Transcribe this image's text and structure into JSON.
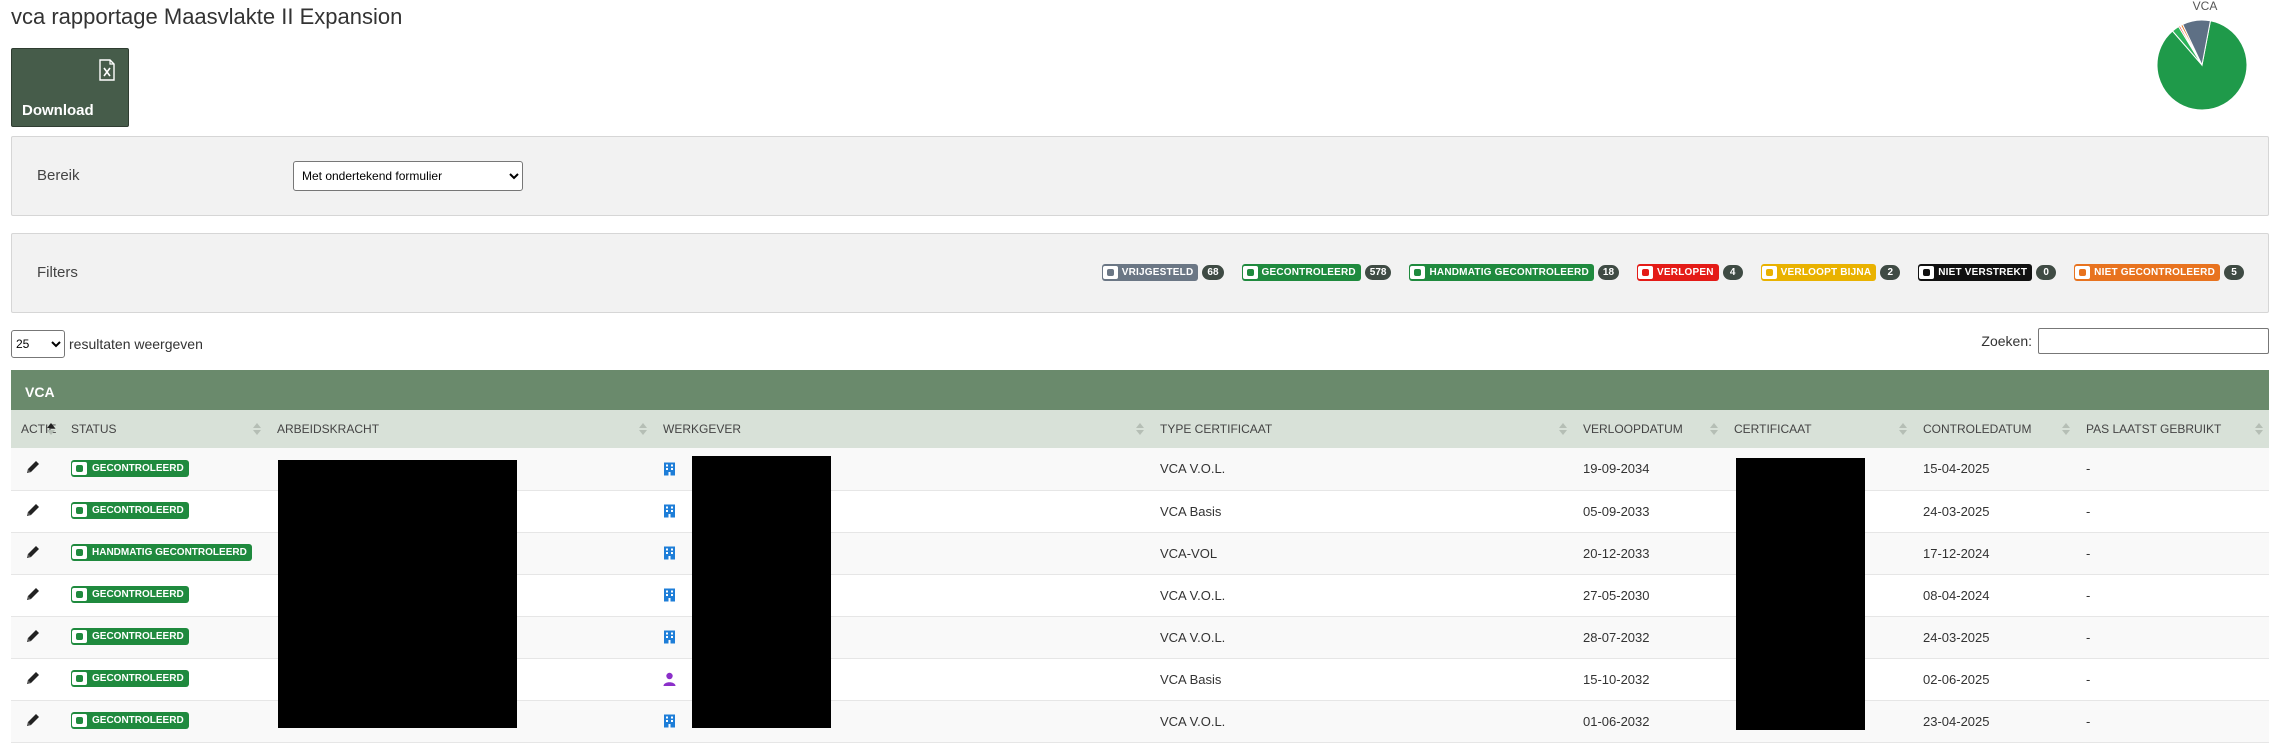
{
  "page": {
    "title": "vca rapportage Maasvlakte II Expansion"
  },
  "toolbar": {
    "download_label": "Download",
    "download_icon": "excel-file-icon"
  },
  "pie": {
    "title": "VCA",
    "slices": [
      {
        "status": "GECONTROLEERD",
        "value": 578,
        "color": "#1f9a4a"
      },
      {
        "status": "HANDMATIG GECONTROLEERD",
        "value": 18,
        "color": "#2db35a"
      },
      {
        "status": "VRIJGESTELD",
        "value": 68,
        "color": "#5e7085"
      },
      {
        "status": "VERLOPEN",
        "value": 4,
        "color": "#e41b17"
      },
      {
        "status": "VERLOOPT BIJNA",
        "value": 2,
        "color": "#e9b200"
      },
      {
        "status": "NIET GECONTROLEERD",
        "value": 5,
        "color": "#e87722"
      }
    ]
  },
  "range": {
    "label": "Bereik",
    "selected": "Met ondertekend formulier"
  },
  "filters": {
    "label": "Filters",
    "items": [
      {
        "label": "VRIJGESTELD",
        "count": "68",
        "color": "#6b7785"
      },
      {
        "label": "GECONTROLEERD",
        "count": "578",
        "color": "#1f8a3e"
      },
      {
        "label": "HANDMATIG GECONTROLEERD",
        "count": "18",
        "color": "#1f8a3e"
      },
      {
        "label": "VERLOPEN",
        "count": "4",
        "color": "#e41b17"
      },
      {
        "label": "VERLOOPT BIJNA",
        "count": "2",
        "color": "#e9b200"
      },
      {
        "label": "NIET VERSTREKT",
        "count": "0",
        "color": "#111111"
      },
      {
        "label": "NIET GECONTROLEERD",
        "count": "5",
        "color": "#e8731f"
      }
    ]
  },
  "table_controls": {
    "page_length": "25",
    "length_suffix": "resultaten weergeven",
    "search_label": "Zoeken:"
  },
  "group": {
    "label": "VCA"
  },
  "table": {
    "columns": [
      "ACTIE",
      "STATUS",
      "ARBEIDSKRACHT",
      "WERKGEVER",
      "TYPE CERTIFICAAT",
      "VERLOOPDATUM",
      "CERTIFICAAT",
      "CONTROLEDATUM",
      "PAS LAATST GEBRUIKT"
    ],
    "rows": [
      {
        "status": "GECONTROLEERD",
        "employer_icon": "building-icon",
        "type": "VCA V.O.L.",
        "expiry": "19-09-2034",
        "checked": "15-04-2025",
        "last_used": "-"
      },
      {
        "status": "GECONTROLEERD",
        "employer_icon": "building-icon",
        "type": "VCA Basis",
        "expiry": "05-09-2033",
        "checked": "24-03-2025",
        "last_used": "-"
      },
      {
        "status": "HANDMATIG GECONTROLEERD",
        "employer_icon": "building-icon",
        "type": "VCA-VOL",
        "expiry": "20-12-2033",
        "checked": "17-12-2024",
        "last_used": "-"
      },
      {
        "status": "GECONTROLEERD",
        "employer_icon": "building-icon",
        "type": "VCA V.O.L.",
        "expiry": "27-05-2030",
        "checked": "08-04-2024",
        "last_used": "-"
      },
      {
        "status": "GECONTROLEERD",
        "employer_icon": "building-icon",
        "type": "VCA V.O.L.",
        "expiry": "28-07-2032",
        "checked": "24-03-2025",
        "last_used": "-"
      },
      {
        "status": "GECONTROLEERD",
        "employer_icon": "person-icon",
        "type": "VCA Basis",
        "expiry": "15-10-2032",
        "checked": "02-06-2025",
        "last_used": "-"
      },
      {
        "status": "GECONTROLEERD",
        "employer_icon": "building-icon",
        "type": "VCA V.O.L.",
        "expiry": "01-06-2032",
        "checked": "23-04-2025",
        "last_used": "-"
      }
    ]
  }
}
